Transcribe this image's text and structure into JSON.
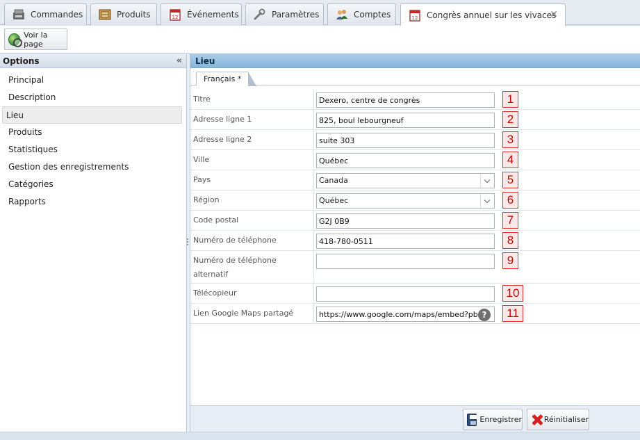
{
  "tabs": [
    {
      "label": "Commandes",
      "icon": "register-icon"
    },
    {
      "label": "Produits",
      "icon": "box-icon"
    },
    {
      "label": "Événements",
      "icon": "calendar-icon"
    },
    {
      "label": "Paramètres",
      "icon": "wrench-icon"
    },
    {
      "label": "Comptes",
      "icon": "users-icon"
    },
    {
      "label": "Congrès annuel sur les vivaces",
      "icon": "calendar-icon",
      "active": true
    }
  ],
  "toolbar": {
    "view_page": "Voir la page"
  },
  "sidebar": {
    "title": "Options",
    "items": [
      {
        "label": "Principal"
      },
      {
        "label": "Description"
      },
      {
        "label": "Lieu",
        "selected": true
      },
      {
        "label": "Produits"
      },
      {
        "label": "Statistiques"
      },
      {
        "label": "Gestion des enregistrements"
      },
      {
        "label": "Catégories"
      },
      {
        "label": "Rapports"
      }
    ]
  },
  "main": {
    "title": "Lieu",
    "lang_tab": "Français *",
    "fields": [
      {
        "label": "Titre",
        "value": "Dexero, centre de congrès",
        "marker": "1"
      },
      {
        "label": "Adresse ligne 1",
        "value": "825, boul lebourgneuf",
        "marker": "2"
      },
      {
        "label": "Adresse ligne 2",
        "value": "suite 303",
        "marker": "3"
      },
      {
        "label": "Ville",
        "value": "Québec",
        "marker": "4"
      },
      {
        "label": "Pays",
        "value": "Canada",
        "marker": "5"
      },
      {
        "label": "Région",
        "value": "Québec",
        "marker": "6"
      },
      {
        "label": "Code postal",
        "value": "G2J 0B9",
        "marker": "7"
      },
      {
        "label": "Numéro de téléphone",
        "value": "418-780-0511",
        "marker": "8"
      },
      {
        "label": "Numéro de téléphone alternatif",
        "value": "",
        "marker": "9"
      },
      {
        "label": "Télécopieur",
        "value": "",
        "marker": "10"
      },
      {
        "label": "Lien Google Maps partagé",
        "value": "https://www.google.com/maps/embed?pb=",
        "marker": "11"
      }
    ]
  },
  "footer": {
    "save": "Enregistrer",
    "reset": "Réinitialiser"
  }
}
